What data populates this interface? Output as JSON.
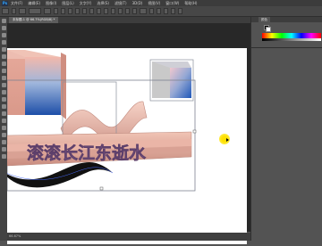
{
  "app": {
    "menu": [
      "文件(F)",
      "编辑(E)",
      "图像(I)",
      "图层(L)",
      "文字(Y)",
      "选择(S)",
      "滤镜(T)",
      "3D(D)",
      "视图(V)",
      "窗口(W)",
      "帮助(H)"
    ]
  },
  "document": {
    "tab_label": "未标题-1 @ 66.7%(RGB/8) *"
  },
  "canvas": {
    "artwork_text": "滚滚长江东逝水"
  },
  "status": {
    "zoom": "66.67%"
  },
  "panels": {
    "color_tab": "颜色"
  }
}
